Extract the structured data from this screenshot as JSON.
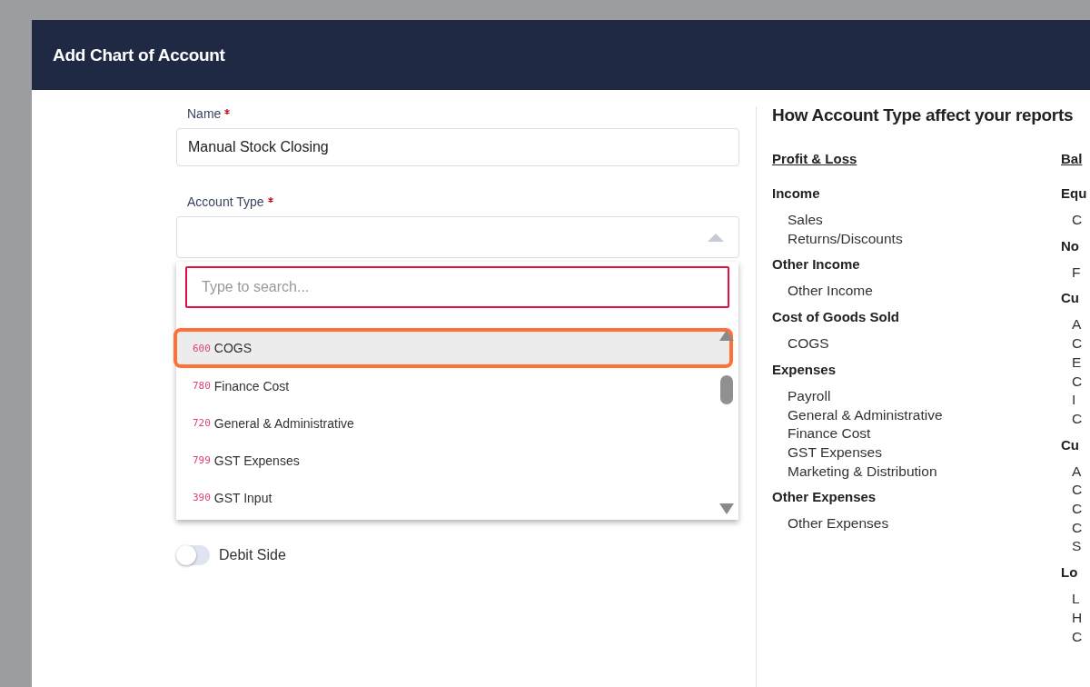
{
  "dialog": {
    "title": "Add Chart of Account"
  },
  "form": {
    "name_field": {
      "label": "Name",
      "required": true,
      "value": "Manual Stock Closing"
    },
    "account_type": {
      "label": "Account Type",
      "required": true,
      "expanded": true,
      "search_placeholder": "Type to search...",
      "options": [
        {
          "code": "600",
          "label": "COGS",
          "highlighted": true
        },
        {
          "code": "780",
          "label": "Finance Cost",
          "highlighted": false
        },
        {
          "code": "720",
          "label": "General & Administrative",
          "highlighted": false
        },
        {
          "code": "799",
          "label": "GST Expenses",
          "highlighted": false
        },
        {
          "code": "390",
          "label": "GST Input",
          "highlighted": false
        }
      ]
    },
    "debit_toggle": {
      "label": "Debit Side",
      "on": false
    }
  },
  "info_panel": {
    "title": "How Account Type affect your reports",
    "columns": [
      {
        "heading": "Profit & Loss",
        "groups": [
          {
            "title": "Income",
            "items": [
              "Sales",
              "Returns/Discounts"
            ]
          },
          {
            "title": "Other Income",
            "items": [
              "Other Income"
            ]
          },
          {
            "title": "Cost of Goods Sold",
            "items": [
              "COGS"
            ]
          },
          {
            "title": "Expenses",
            "items": [
              "Payroll",
              "General & Administrative",
              "Finance Cost",
              "GST Expenses",
              "Marketing & Distribution"
            ]
          },
          {
            "title": "Other Expenses",
            "items": [
              "Other Expenses"
            ]
          }
        ]
      },
      {
        "heading": "Bal",
        "groups": [
          {
            "title": "Equ",
            "items": [
              "C"
            ]
          },
          {
            "title": "No",
            "items": [
              "F"
            ]
          },
          {
            "title": "Cu",
            "items": [
              "A",
              "C",
              "E",
              "C",
              "I",
              "C"
            ]
          },
          {
            "title": "Cu",
            "items": [
              "A",
              "C",
              "C",
              "C",
              "S"
            ]
          },
          {
            "title": "Lo",
            "items": [
              "L",
              "H",
              "C"
            ]
          }
        ]
      }
    ]
  }
}
